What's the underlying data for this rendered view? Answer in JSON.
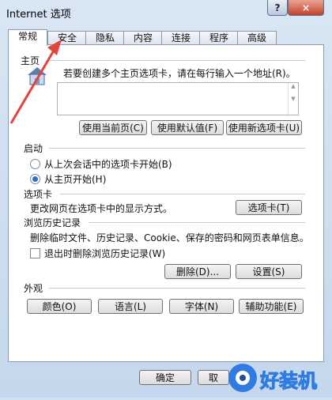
{
  "window": {
    "title": "Internet 选项",
    "help_label": "?",
    "close_label": "×"
  },
  "tabs": [
    "常规",
    "安全",
    "隐私",
    "内容",
    "连接",
    "程序",
    "高级"
  ],
  "homepage": {
    "heading": "主页",
    "description": "若要创建多个主页选项卡，请在每行输入一个地址(R)。",
    "buttons": [
      "使用当前页(C)",
      "使用默认值(F)",
      "使用新选项卡(U)"
    ]
  },
  "startup": {
    "heading": "启动",
    "options": [
      "从上次会话中的选项卡开始(B)",
      "从主页开始(H)"
    ],
    "selected": 1
  },
  "tabs_section": {
    "heading": "选项卡",
    "description": "更改网页在选项卡中的显示方式。",
    "button": "选项卡(T)"
  },
  "history": {
    "heading": "浏览历史记录",
    "description": "删除临时文件、历史记录、Cookie、保存的密码和网页表单信息。",
    "checkbox_label": "退出时删除浏览历史记录(W)",
    "delete_button": "删除(D)...",
    "settings_button": "设置(S)"
  },
  "appearance": {
    "heading": "外观",
    "buttons": [
      "颜色(O)",
      "语言(L)",
      "字体(N)",
      "辅助功能(E)"
    ]
  },
  "footer": {
    "ok": "确定",
    "cancel": "取"
  },
  "watermark": {
    "text": "好装机"
  },
  "colors": {
    "arrow": "#e0443a",
    "selected_radio": "#2a6fc9"
  }
}
